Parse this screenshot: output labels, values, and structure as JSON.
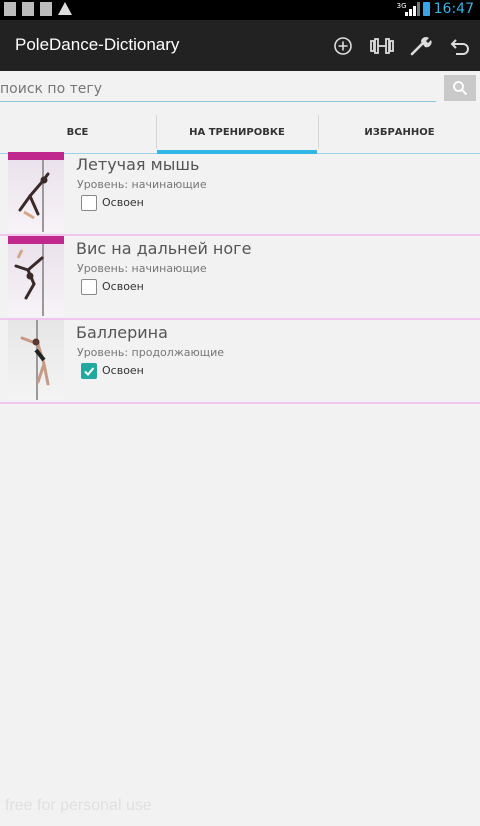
{
  "status_bar": {
    "time": "16:47",
    "network": "3G",
    "notification_icons": [
      "notification-icon-1",
      "notification-icon-2",
      "notification-icon-3",
      "warning-icon"
    ],
    "clock_color": "#33b5e5"
  },
  "app_bar": {
    "title": "PoleDance-Dictionary",
    "actions": [
      "add-icon",
      "dumbbell-icon",
      "wrench-icon",
      "undo-icon"
    ]
  },
  "search": {
    "placeholder": "поиск по тегу",
    "button_icon": "search-icon"
  },
  "tabs": [
    {
      "label": "ВСЕ",
      "active": false
    },
    {
      "label": "НА ТРЕНИРОВКЕ",
      "active": true
    },
    {
      "label": "ИЗБРАННОЕ",
      "active": false
    }
  ],
  "accent_color": "#33b5e5",
  "items": [
    {
      "title": "Летучая мышь",
      "level": "Уровень: начинающие",
      "checkbox_label": "Освоен",
      "checked": false
    },
    {
      "title": "Вис на дальней ноге",
      "level": "Уровень: начинающие",
      "checkbox_label": "Освоен",
      "checked": false
    },
    {
      "title": "Баллерина",
      "level": "Уровень: продолжающие",
      "checkbox_label": "Освоен",
      "checked": true
    }
  ],
  "watermark": "free for personal use"
}
